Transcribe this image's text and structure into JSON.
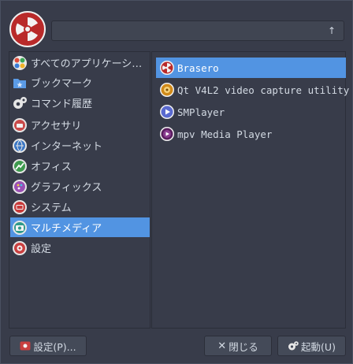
{
  "search": {
    "value": "",
    "clear_glyph": "↑"
  },
  "categories": [
    {
      "label": "すべてのアプリケーシ…",
      "icon": "all-apps-icon"
    },
    {
      "label": "ブックマーク",
      "icon": "bookmark-folder-icon"
    },
    {
      "label": "コマンド履歴",
      "icon": "gears-icon"
    },
    {
      "label": "アクセサリ",
      "icon": "accessories-icon"
    },
    {
      "label": "インターネット",
      "icon": "internet-icon"
    },
    {
      "label": "オフィス",
      "icon": "office-icon"
    },
    {
      "label": "グラフィックス",
      "icon": "graphics-icon"
    },
    {
      "label": "システム",
      "icon": "system-icon"
    },
    {
      "label": "マルチメディア",
      "icon": "multimedia-icon",
      "selected": true
    },
    {
      "label": "設定",
      "icon": "settings-icon"
    }
  ],
  "apps": [
    {
      "label": "Brasero",
      "icon": "brasero-icon",
      "selected": true
    },
    {
      "label": "Qt V4L2 video capture utility",
      "icon": "qv4l2-icon"
    },
    {
      "label": "SMPlayer",
      "icon": "smplayer-icon"
    },
    {
      "label": "mpv Media Player",
      "icon": "mpv-icon"
    }
  ],
  "footer": {
    "settings_label": "設定(P)...",
    "close_label": "閉じる",
    "launch_label": "起動(U)"
  },
  "colors": {
    "accent": "#5294e2",
    "background": "#383c4a",
    "logo": "#b92a2a"
  }
}
